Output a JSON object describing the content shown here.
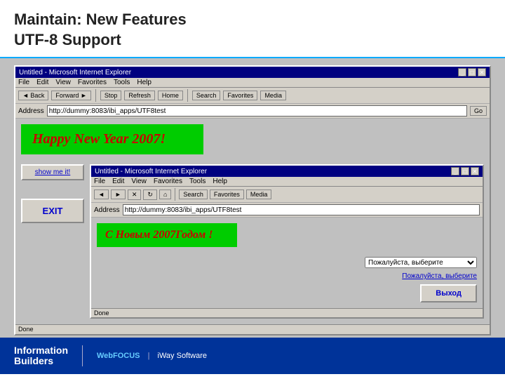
{
  "header": {
    "line1": "Maintain: New Features",
    "line2": "UTF-8 Support"
  },
  "outer_browser": {
    "titlebar": "Untitled - Microsoft Internet Explorer",
    "menu_items": [
      "File",
      "Edit",
      "View",
      "Favorites",
      "Tools",
      "Help"
    ],
    "toolbar_buttons": [
      "Back",
      "Forward",
      "Stop",
      "Refresh",
      "Home",
      "Search",
      "Favorites",
      "Media"
    ],
    "address_label": "Address",
    "address_value": "http://dummy:8083/ibi_apps/UTF8test",
    "go_label": "Go",
    "happy_text": "Happy New Year 2007!",
    "sidebar_link": "show me it!",
    "exit_label": "EXIT",
    "status": "Done"
  },
  "inner_browser": {
    "titlebar": "Untitled - Microsoft Internet Explorer",
    "menu_items": [
      "File",
      "Edit",
      "View",
      "Favorites",
      "Tools",
      "Help"
    ],
    "address_label": "Address",
    "address_value": "http://dummy:8083/ibi_apps/UTF8test",
    "happy_text": "С Новым 2007Годом !",
    "dropdown_placeholder": "Пожалуйста, выберите",
    "link_label": "Пожалуйста, выберите",
    "exit_label": "Выход",
    "status": "Done"
  },
  "footer": {
    "company_line1": "Information",
    "company_line2": "Builders",
    "product1": "WebFOCUS",
    "separator": "|",
    "product2": "iWay Software"
  }
}
